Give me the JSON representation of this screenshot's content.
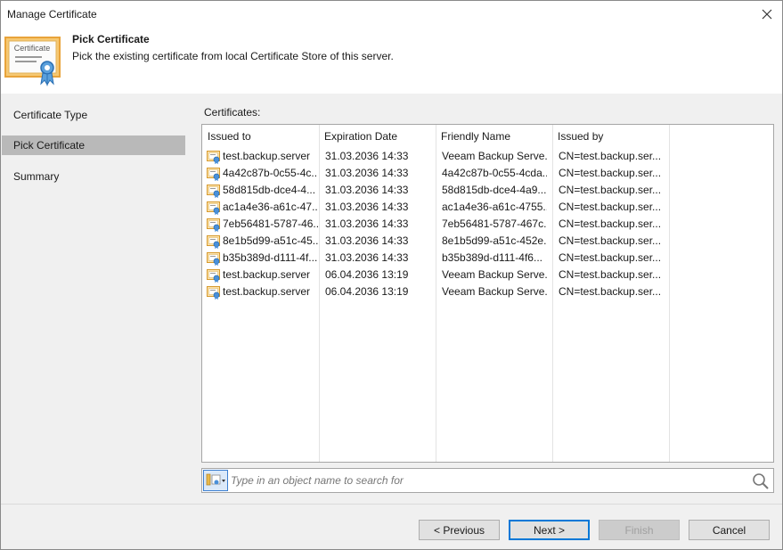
{
  "window": {
    "title": "Manage Certificate",
    "close_glyph": "✕"
  },
  "header": {
    "title": "Pick Certificate",
    "description": "Pick the existing certificate from local Certificate Store of this server.",
    "icon_text": "Certificate"
  },
  "sidebar": {
    "items": [
      {
        "label": "Certificate Type",
        "active": false
      },
      {
        "label": "Pick Certificate",
        "active": true
      },
      {
        "label": "Summary",
        "active": false
      }
    ]
  },
  "main": {
    "certificates_label": "Certificates:",
    "columns": [
      "Issued to",
      "Expiration Date",
      "Friendly Name",
      "Issued by"
    ],
    "rows": [
      [
        "test.backup.server",
        "31.03.2036 14:33",
        "Veeam Backup Serve...",
        "CN=test.backup.ser..."
      ],
      [
        "4a42c87b-0c55-4c...",
        "31.03.2036 14:33",
        "4a42c87b-0c55-4cda...",
        "CN=test.backup.ser..."
      ],
      [
        "58d815db-dce4-4...",
        "31.03.2036 14:33",
        "58d815db-dce4-4a9...",
        "CN=test.backup.ser..."
      ],
      [
        "ac1a4e36-a61c-47...",
        "31.03.2036 14:33",
        "ac1a4e36-a61c-4755...",
        "CN=test.backup.ser..."
      ],
      [
        "7eb56481-5787-46...",
        "31.03.2036 14:33",
        "7eb56481-5787-467c...",
        "CN=test.backup.ser..."
      ],
      [
        "8e1b5d99-a51c-45...",
        "31.03.2036 14:33",
        "8e1b5d99-a51c-452e...",
        "CN=test.backup.ser..."
      ],
      [
        "b35b389d-d111-4f...",
        "31.03.2036 14:33",
        "b35b389d-d111-4f6...",
        "CN=test.backup.ser..."
      ],
      [
        "test.backup.server",
        "06.04.2036 13:19",
        "Veeam Backup Serve...",
        "CN=test.backup.ser..."
      ],
      [
        "test.backup.server",
        "06.04.2036 13:19",
        "Veeam Backup Serve...",
        "CN=test.backup.ser..."
      ]
    ],
    "search": {
      "placeholder": "Type in an object name to search for",
      "value": ""
    }
  },
  "footer": {
    "previous_label": "< Previous",
    "next_label": "Next >",
    "finish_label": "Finish",
    "cancel_label": "Cancel"
  },
  "colors": {
    "accent": "#0078d7",
    "selected_nav": "#b9b9b9",
    "panel_bg": "#f0f0f0",
    "cert_icon": "#e8a33a"
  }
}
